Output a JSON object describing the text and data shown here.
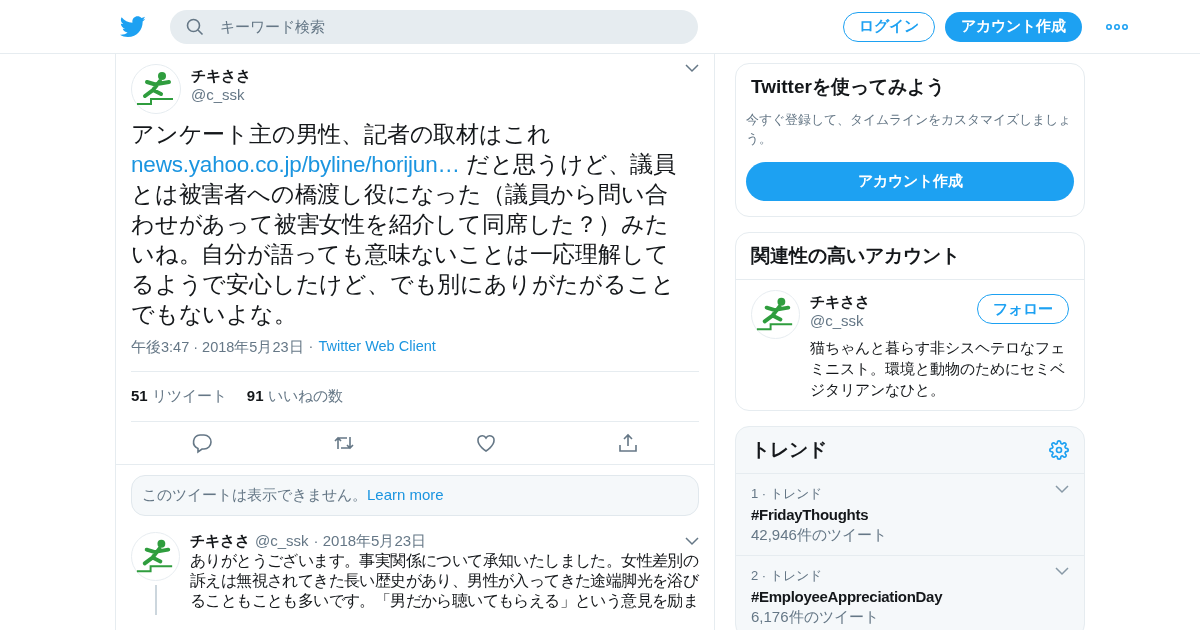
{
  "header": {
    "search": {
      "placeholder": "キーワード検索"
    },
    "login": "ログイン",
    "signup": "アカウント作成"
  },
  "tweet": {
    "name": "チキささ",
    "handle": "@c_ssk",
    "body": [
      {
        "kind": "text",
        "text": "アンケート主の男性、記者の取材はこれ "
      },
      {
        "kind": "link",
        "text": "news.yahoo.co.jp/byline/horijun…"
      },
      {
        "kind": "text",
        "text": " だと思うけど、議員とは被害者への橋渡し役になった（議員から問い合わせがあって被害女性を紹介して同席した？）みたいね。自分が語っても意味ないことは一応理解してるようで安心したけど、でも別にありがたがることでもないよな。"
      }
    ],
    "time": "午後3:47 · 2018年5月23日",
    "separator": "·",
    "client": "Twitter Web Client",
    "stats": [
      {
        "count": "51",
        "label": "リツイート"
      },
      {
        "count": "91",
        "label": "いいねの数"
      }
    ]
  },
  "notice": {
    "text": "このツイートは表示できません。",
    "link": "Learn more"
  },
  "reply": {
    "name": "チキささ",
    "handle": "@c_ssk",
    "date": "· 2018年5月23日",
    "text": "ありがとうございます。事実関係について承知いたしました。女性差別の訴えは無視されてきた長い歴史があり、男性が入ってきた途端脚光を浴びることもことも多いです。「男だから聴いてもらえる」という意見を励ま"
  },
  "signup_card": {
    "title": "Twitterを使ってみよう",
    "text": "今すぐ登録して、タイムラインをカスタマイズしましょう。",
    "button": "アカウント作成"
  },
  "related": {
    "title": "関連性の高いアカウント",
    "accounts": [
      {
        "name": "チキささ",
        "handle": "@c_ssk",
        "follow": "フォロー",
        "bio": "猫ちゃんと暮らす非シスヘテロなフェミニスト。環境と動物のためにセミベジタリアンなひと。"
      }
    ]
  },
  "trends": {
    "title": "トレンド",
    "items": [
      {
        "rank": "1 · トレンド",
        "tag": "#FridayThoughts",
        "count": "42,946件のツイート"
      },
      {
        "rank": "2 · トレンド",
        "tag": "#EmployeeAppreciationDay",
        "count": "6,176件のツイート"
      }
    ]
  }
}
